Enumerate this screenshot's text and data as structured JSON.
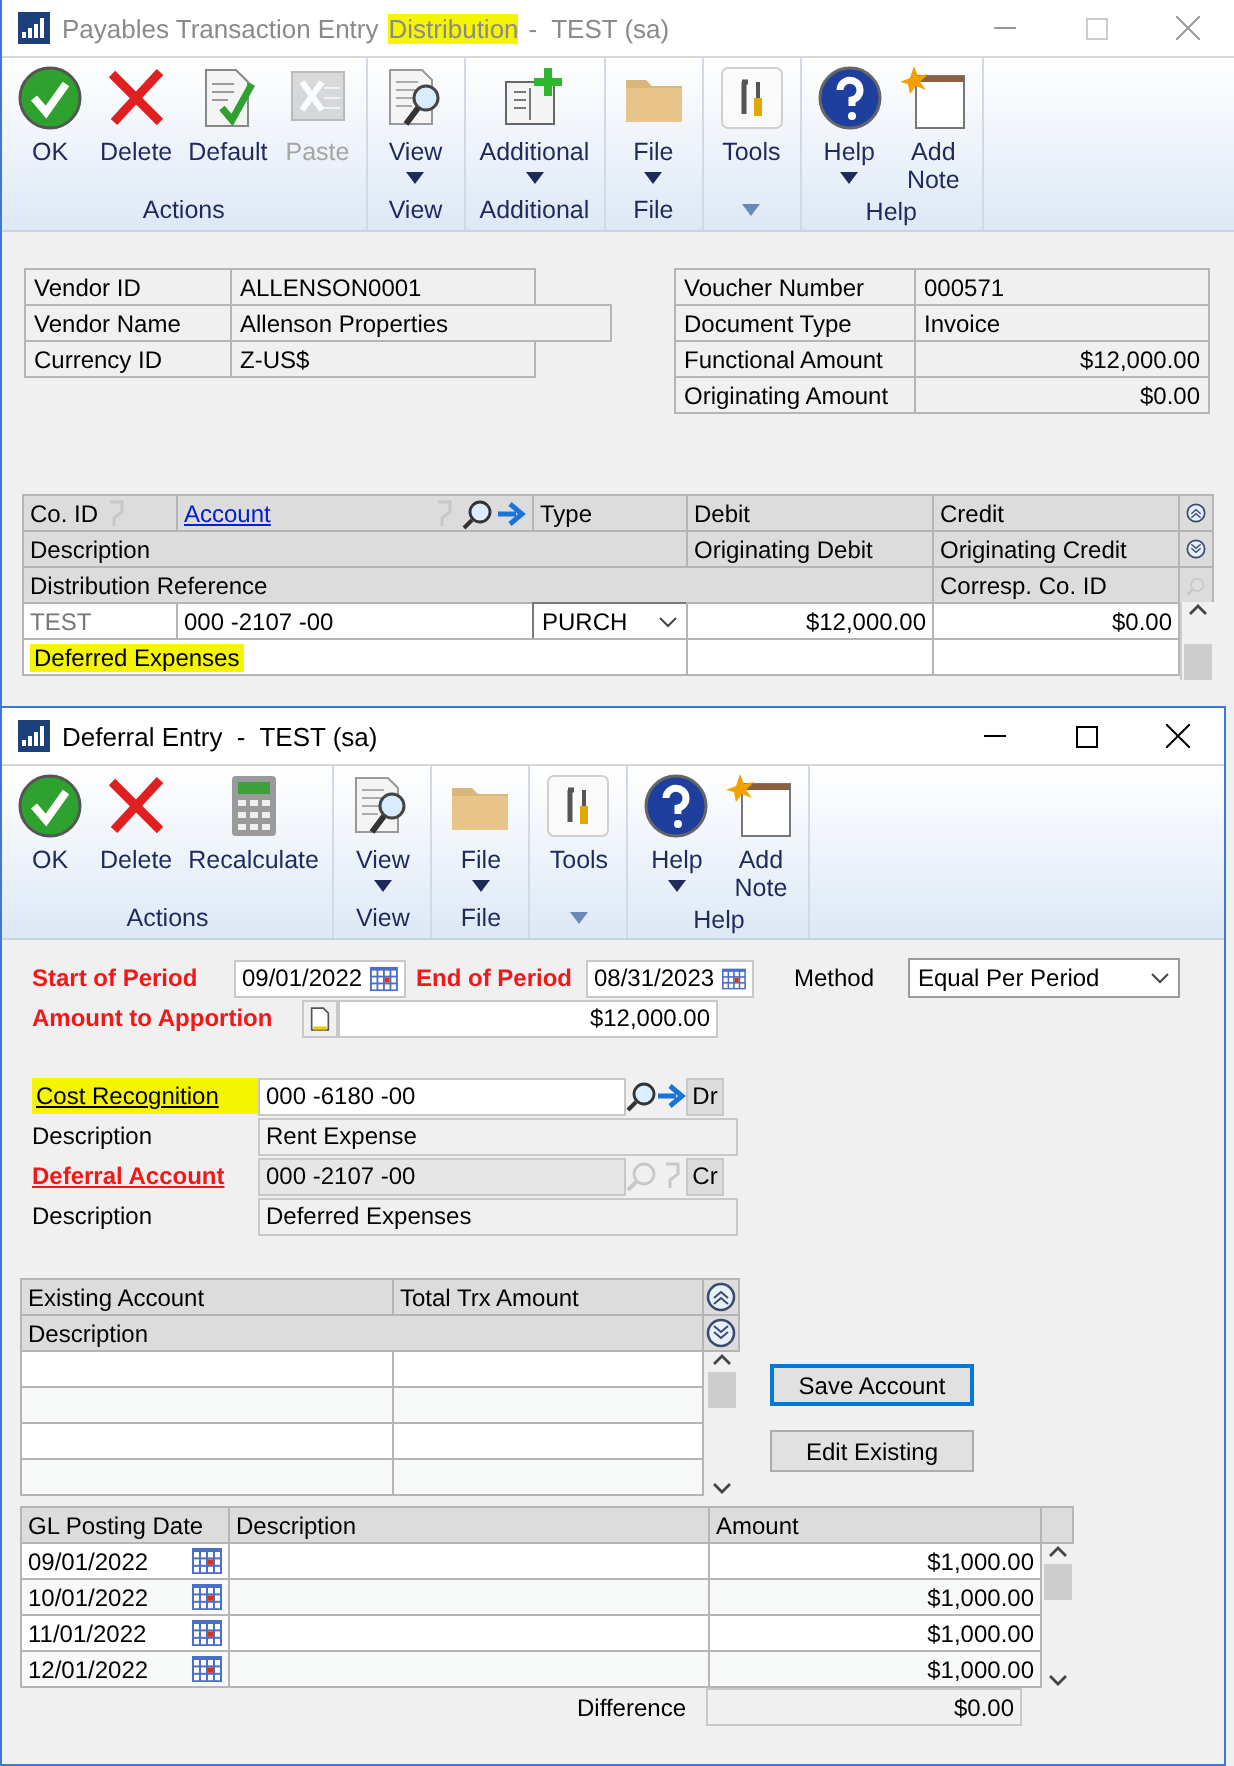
{
  "back_window": {
    "title": [
      {
        "text": "Payables Transaction Entry",
        "highlighted": false
      },
      {
        "text": "Distribution",
        "highlighted": true
      },
      {
        "text": "-  TEST (sa)",
        "highlighted": false
      }
    ],
    "maximize_disabled": true,
    "ribbon": [
      {
        "label": "Actions",
        "buttons": [
          {
            "label": "OK",
            "kind": "ok",
            "disabled": false,
            "dropdown": false
          },
          {
            "label": "Delete",
            "kind": "delete",
            "disabled": false,
            "dropdown": false
          },
          {
            "label": "Default",
            "kind": "default",
            "disabled": false,
            "dropdown": false
          },
          {
            "label": "Paste",
            "kind": "paste",
            "disabled": true,
            "dropdown": false
          }
        ]
      },
      {
        "label": "View",
        "buttons": [
          {
            "label": "View",
            "kind": "view",
            "disabled": false,
            "dropdown": true
          }
        ]
      },
      {
        "label": "Additional",
        "buttons": [
          {
            "label": "Additional",
            "kind": "additional",
            "disabled": false,
            "dropdown": true
          }
        ]
      },
      {
        "label": "File",
        "buttons": [
          {
            "label": "File",
            "kind": "file",
            "disabled": false,
            "dropdown": true
          }
        ]
      },
      {
        "buttons": [
          {
            "label": "Tools",
            "kind": "tools",
            "disabled": false,
            "dropdown": false
          }
        ]
      },
      {
        "label": "Help",
        "buttons": [
          {
            "label": "Help",
            "kind": "help",
            "disabled": false,
            "dropdown": true
          },
          {
            "label": "Add Note",
            "kind": "note",
            "disabled": false,
            "dropdown": false
          }
        ]
      }
    ],
    "vendor_fields": [
      {
        "label": "Vendor ID",
        "value": "ALLENSON0001",
        "kind": "short"
      },
      {
        "label": "Vendor Name",
        "value": "Allenson Properties",
        "kind": "long"
      },
      {
        "label": "Currency ID",
        "value": "Z-US$",
        "kind": "short"
      }
    ],
    "document_fields": [
      {
        "label": "Voucher Number",
        "value": "000571",
        "kind": "text"
      },
      {
        "label": "Document Type",
        "value": "Invoice",
        "kind": "text"
      },
      {
        "label": "Functional Amount",
        "value": "$12,000.00",
        "kind": "amount"
      },
      {
        "label": "Originating Amount",
        "value": "$0.00",
        "kind": "amount"
      }
    ],
    "grid": {
      "columns": {
        "co_id": "Co. ID",
        "account": {
          "label": "Account",
          "link": true
        },
        "type": "Type",
        "debit": "Debit",
        "credit": "Credit",
        "description": "Description",
        "originating_debit": "Originating Debit",
        "originating_credit": "Originating Credit",
        "distribution_reference": "Distribution Reference",
        "corresp_co_id": "Corresp. Co. ID"
      },
      "rows": [
        {
          "co_id": "TEST",
          "account": "000 -2107 -00",
          "type": "PURCH",
          "debit": "$12,000.00",
          "credit": "$0.00",
          "description": "Deferred Expenses",
          "description_highlighted": true
        }
      ]
    }
  },
  "front_window": {
    "title": "Deferral Entry  -  TEST (sa)",
    "ribbon": [
      {
        "label": "Actions",
        "buttons": [
          {
            "label": "OK",
            "kind": "ok",
            "disabled": false,
            "dropdown": false
          },
          {
            "label": "Delete",
            "kind": "delete",
            "disabled": false,
            "dropdown": false
          },
          {
            "label": "Recalculate",
            "kind": "calculator",
            "disabled": false,
            "dropdown": false
          }
        ]
      },
      {
        "label": "View",
        "buttons": [
          {
            "label": "View",
            "kind": "view",
            "disabled": false,
            "dropdown": true
          }
        ]
      },
      {
        "label": "File",
        "buttons": [
          {
            "label": "File",
            "kind": "file",
            "disabled": false,
            "dropdown": true
          }
        ]
      },
      {
        "buttons": [
          {
            "label": "Tools",
            "kind": "tools",
            "disabled": false,
            "dropdown": false
          }
        ]
      },
      {
        "label": "Help",
        "buttons": [
          {
            "label": "Help",
            "kind": "help",
            "disabled": false,
            "dropdown": true
          },
          {
            "label": "Add Note",
            "kind": "note",
            "disabled": false,
            "dropdown": false
          }
        ]
      }
    ],
    "start_of_period": {
      "label": "Start of Period",
      "value": "09/01/2022",
      "required": true
    },
    "end_of_period": {
      "label": "End of Period",
      "value": "08/31/2023",
      "required": true
    },
    "method": {
      "label": "Method",
      "value": "Equal Per Period"
    },
    "amount_to_apportion": {
      "label": "Amount to Apportion",
      "value": "$12,000.00",
      "required": true
    },
    "cost_recognition": {
      "label": "Cost Recognition",
      "value": "000 -6180 -00",
      "required": false,
      "link": true,
      "highlighted": true,
      "disabled": false,
      "side": "Dr"
    },
    "cost_description": {
      "label": "Description",
      "value": "Rent Expense"
    },
    "deferral_account": {
      "label": "Deferral Account",
      "value": "000 -2107 -00",
      "required": true,
      "link": true,
      "highlighted": false,
      "disabled": true,
      "side": "Cr"
    },
    "deferral_description": {
      "label": "Description",
      "value": "Deferred Expenses"
    },
    "existing_grid": {
      "columns": [
        "Existing Account",
        "Total Trx Amount"
      ],
      "second_header": "Description"
    },
    "buttons": [
      {
        "label": "Save Account",
        "focused": true
      },
      {
        "label": "Edit Existing",
        "focused": false
      }
    ],
    "schedule": {
      "columns": [
        "GL Posting Date",
        "Description",
        "Amount"
      ],
      "rows": [
        {
          "date": "09/01/2022",
          "amount": "$1,000.00"
        },
        {
          "date": "10/01/2022",
          "amount": "$1,000.00"
        },
        {
          "date": "11/01/2022",
          "amount": "$1,000.00"
        },
        {
          "date": "12/01/2022",
          "amount": "$1,000.00"
        }
      ],
      "difference": {
        "label": "Difference",
        "value": "$0.00"
      }
    }
  }
}
